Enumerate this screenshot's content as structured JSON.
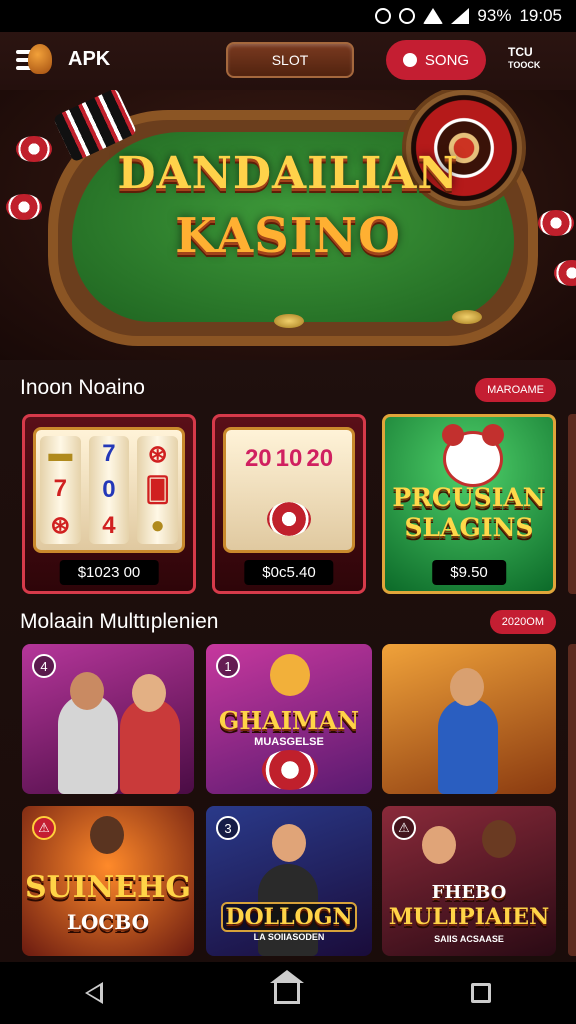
{
  "status_bar": {
    "battery": "93%",
    "time": "19:05"
  },
  "header": {
    "app_label": "APK",
    "slot_button": "SLOT",
    "song_button": "SONG",
    "right_line1": "TCU",
    "right_line2": "TOOCK"
  },
  "hero": {
    "title_line1": "DANDAILIAN",
    "title_line2": "KASINO"
  },
  "section1": {
    "title": "Inoon Noaino",
    "badge": "MAROAME",
    "cards": [
      {
        "reels": [
          [
            "🍞",
            "7",
            "🎰"
          ],
          [
            "7",
            "0",
            "🟦"
          ],
          [
            "7",
            "4",
            "🥚"
          ]
        ],
        "price": "$1023 00"
      },
      {
        "reels": [
          [
            "20",
            "10",
            "20"
          ]
        ],
        "price": "$0c5.40"
      },
      {
        "title_line1": "PRCUSIAN",
        "title_line2": "SLAGINS",
        "price": "$9.50"
      }
    ]
  },
  "section2": {
    "title": "Molaain Multtıplenien",
    "badge": "2020OM",
    "cards": [
      {
        "num": "4",
        "accent": "#a2329c"
      },
      {
        "num": "1",
        "title": "GHAIMAN",
        "subtitle": "MUASGELSE"
      },
      {
        "num": "",
        "accent": "#c06c1e"
      },
      {
        "num": "⚠",
        "title_line1": "SUINEHG",
        "title_line2": "LOCBO"
      },
      {
        "num": "3",
        "title": "DOLLOGN",
        "subtitle": "LA SOIIASODEN"
      },
      {
        "num": "⚠",
        "title_line1": "FHEBO",
        "title_line2": "MULIPIAIEN",
        "subtitle": "SAIIS ACSAASE"
      }
    ]
  },
  "navbar": {
    "back": "back-icon",
    "home": "home-icon",
    "recent": "recent-apps-icon"
  },
  "colors": {
    "accent_red": "#c41e32",
    "gold": "#ffd24a",
    "felt_green": "#2f8a2f"
  }
}
